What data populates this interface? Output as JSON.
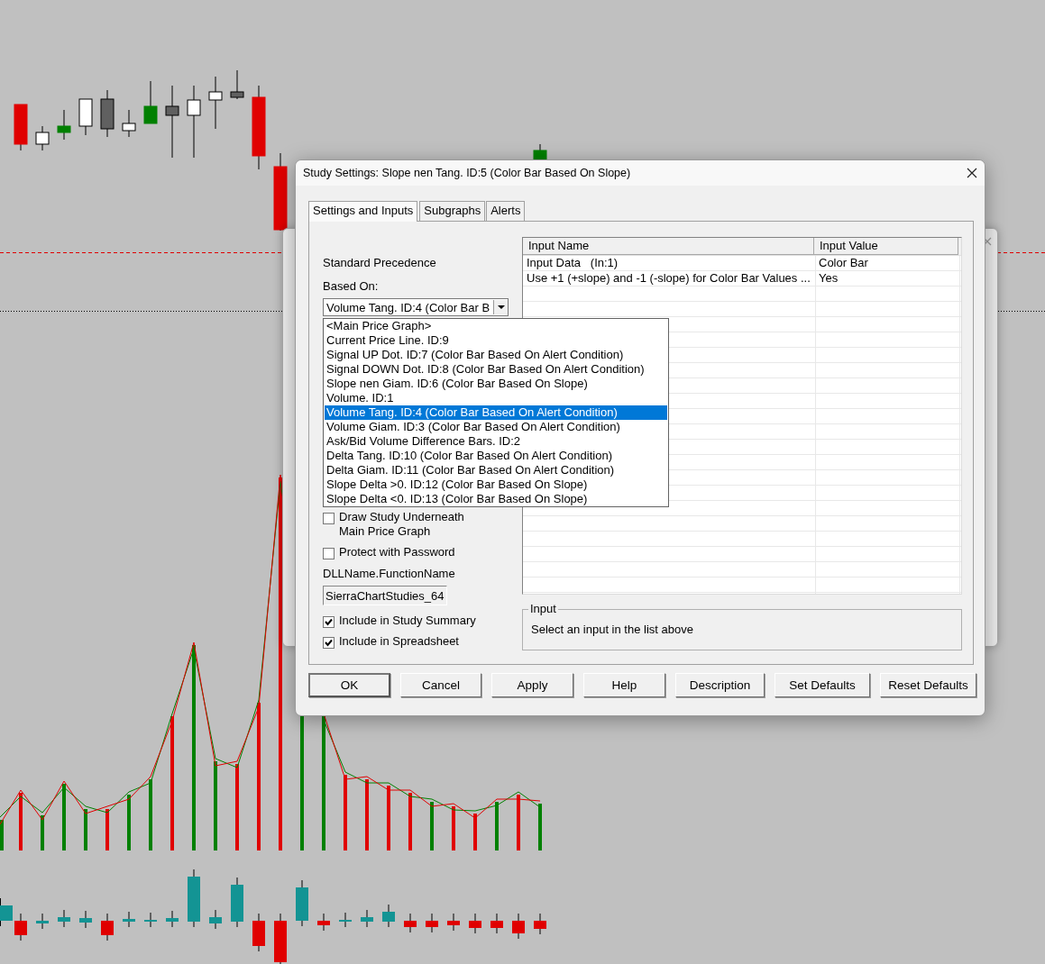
{
  "dialog": {
    "title": "Study Settings: Slope nen Tang. ID:5 (Color Bar Based On Slope)"
  },
  "tabs": [
    {
      "label": "Settings and Inputs",
      "selected": true
    },
    {
      "label": "Subgraphs",
      "selected": false
    },
    {
      "label": "Alerts",
      "selected": false
    }
  ],
  "settings": {
    "precedence_label": "Standard Precedence",
    "based_on_label": "Based On:",
    "based_on_value": "Volume Tang. ID:4 (Color Bar B",
    "based_on_options": [
      {
        "label": "<Main Price Graph>",
        "selected": false
      },
      {
        "label": "Current Price Line. ID:9",
        "selected": false
      },
      {
        "label": "Signal UP Dot. ID:7 (Color Bar Based On Alert Condition)",
        "selected": false
      },
      {
        "label": "Signal DOWN Dot. ID:8 (Color Bar Based On Alert Condition)",
        "selected": false
      },
      {
        "label": "Slope nen Giam. ID:6 (Color Bar Based On Slope)",
        "selected": false
      },
      {
        "label": "Volume. ID:1",
        "selected": false
      },
      {
        "label": "Volume Tang. ID:4 (Color Bar Based On Alert Condition)",
        "selected": true
      },
      {
        "label": "Volume Giam. ID:3 (Color Bar Based On Alert Condition)",
        "selected": false
      },
      {
        "label": "Ask/Bid Volume Difference Bars. ID:2",
        "selected": false
      },
      {
        "label": "Delta Tang. ID:10 (Color Bar Based On Alert Condition)",
        "selected": false
      },
      {
        "label": "Delta Giam. ID:11 (Color Bar Based On Alert Condition)",
        "selected": false
      },
      {
        "label": "Slope Delta >0. ID:12 (Color Bar Based On Slope)",
        "selected": false
      },
      {
        "label": "Slope Delta <0. ID:13 (Color Bar Based On Slope)",
        "selected": false
      }
    ],
    "options_top": [
      {
        "label": "Draw Study Underneath Main Price Graph",
        "checked": false
      },
      {
        "label": "Protect with Password",
        "checked": false
      }
    ],
    "dll_label": "DLLName.FunctionName",
    "dll_value": "SierraChartStudies_64",
    "options_bottom": [
      {
        "label": "Include in Study Summary",
        "checked": true
      },
      {
        "label": "Include in Spreadsheet",
        "checked": true
      }
    ]
  },
  "inputs_table": {
    "columns": [
      "Input Name",
      "Input Value"
    ],
    "rows": [
      {
        "name": "Input Data   (In:1)",
        "value": "Color Bar"
      },
      {
        "name": "Use +1 (+slope) and -1 (-slope) for Color Bar Values ...",
        "value": "Yes"
      }
    ]
  },
  "input_group": {
    "title": "Input",
    "text": "Select an input in the list above"
  },
  "buttons": [
    {
      "label": "OK",
      "default": true
    },
    {
      "label": "Cancel",
      "default": false
    },
    {
      "label": "Apply",
      "default": false
    },
    {
      "label": "Help",
      "default": false
    },
    {
      "label": "Description",
      "default": false
    },
    {
      "label": "Set Defaults",
      "default": false
    },
    {
      "label": "Reset Defaults",
      "default": false
    }
  ]
}
